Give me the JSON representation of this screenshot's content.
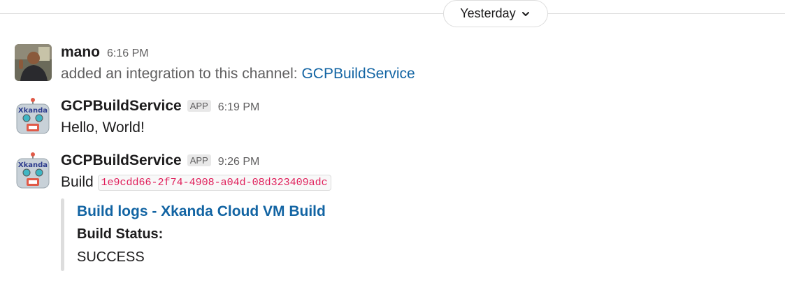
{
  "date_divider": {
    "label": "Yesterday"
  },
  "messages": [
    {
      "author": "mano",
      "time": "6:16 PM",
      "text": "added an integration to this channel:",
      "link": "GCPBuildService"
    },
    {
      "author": "GCPBuildService",
      "badge": "APP",
      "time": "6:19 PM",
      "text": "Hello, World!",
      "avatar_text": "Xkanda"
    },
    {
      "author": "GCPBuildService",
      "badge": "APP",
      "time": "9:26 PM",
      "text": "Build",
      "code": "1e9cdd66-2f74-4908-a04d-08d323409adc",
      "avatar_text": "Xkanda",
      "attachment": {
        "title": "Build logs - Xkanda Cloud VM Build",
        "label": "Build Status:",
        "value": "SUCCESS"
      }
    }
  ],
  "colors": {
    "link": "#1264a3",
    "code": "#e01e5a",
    "robot_face": "#c8d1d8",
    "robot_eyes": "#3fb6c4",
    "robot_mouth": "#e05a48"
  }
}
